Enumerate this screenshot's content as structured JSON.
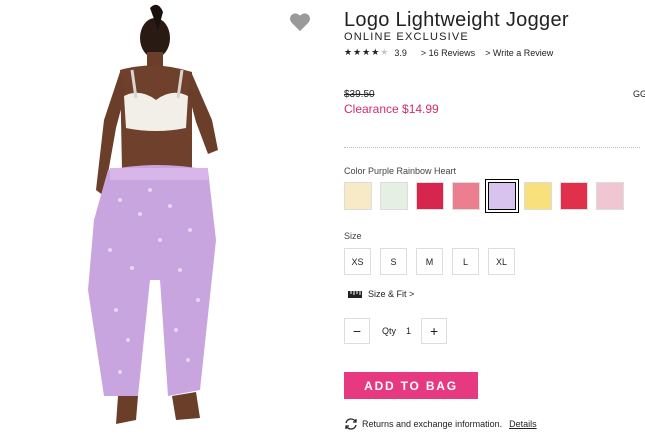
{
  "product": {
    "title": "Logo Lightweight Jogger",
    "subtitle": "ONLINE EXCLUSIVE",
    "rating": "3.9",
    "reviews_link": "> 16 Reviews",
    "write_review_link": "> Write a Review",
    "original_price": "$39.50",
    "clearance_price": "Clearance $14.99",
    "edge_text": "GG"
  },
  "color": {
    "label": "Color Purple Rainbow Heart",
    "swatches": [
      {
        "name": "swatch-1",
        "color": "#f8e9c7"
      },
      {
        "name": "swatch-2",
        "color": "#e5efe3"
      },
      {
        "name": "swatch-3",
        "color": "#d7264d"
      },
      {
        "name": "swatch-4",
        "color": "#ec7f8f"
      },
      {
        "name": "swatch-5",
        "color": "#d8c3ee"
      },
      {
        "name": "swatch-6",
        "color": "#f8e07d"
      },
      {
        "name": "swatch-7",
        "color": "#e0304b"
      },
      {
        "name": "swatch-8",
        "color": "#f1c6d3"
      }
    ]
  },
  "size": {
    "label": "Size",
    "options": [
      "XS",
      "S",
      "M",
      "L",
      "XL"
    ],
    "size_fit": "Size & Fit >"
  },
  "quantity": {
    "label": "Qty",
    "value": "1",
    "minus": "−",
    "plus": "+"
  },
  "actions": {
    "add_to_bag": "ADD TO BAG"
  },
  "returns": {
    "text": "Returns and exchange information.",
    "details": "Details"
  },
  "colors": {
    "accent": "#e63980",
    "clearance": "#d22c6c"
  }
}
